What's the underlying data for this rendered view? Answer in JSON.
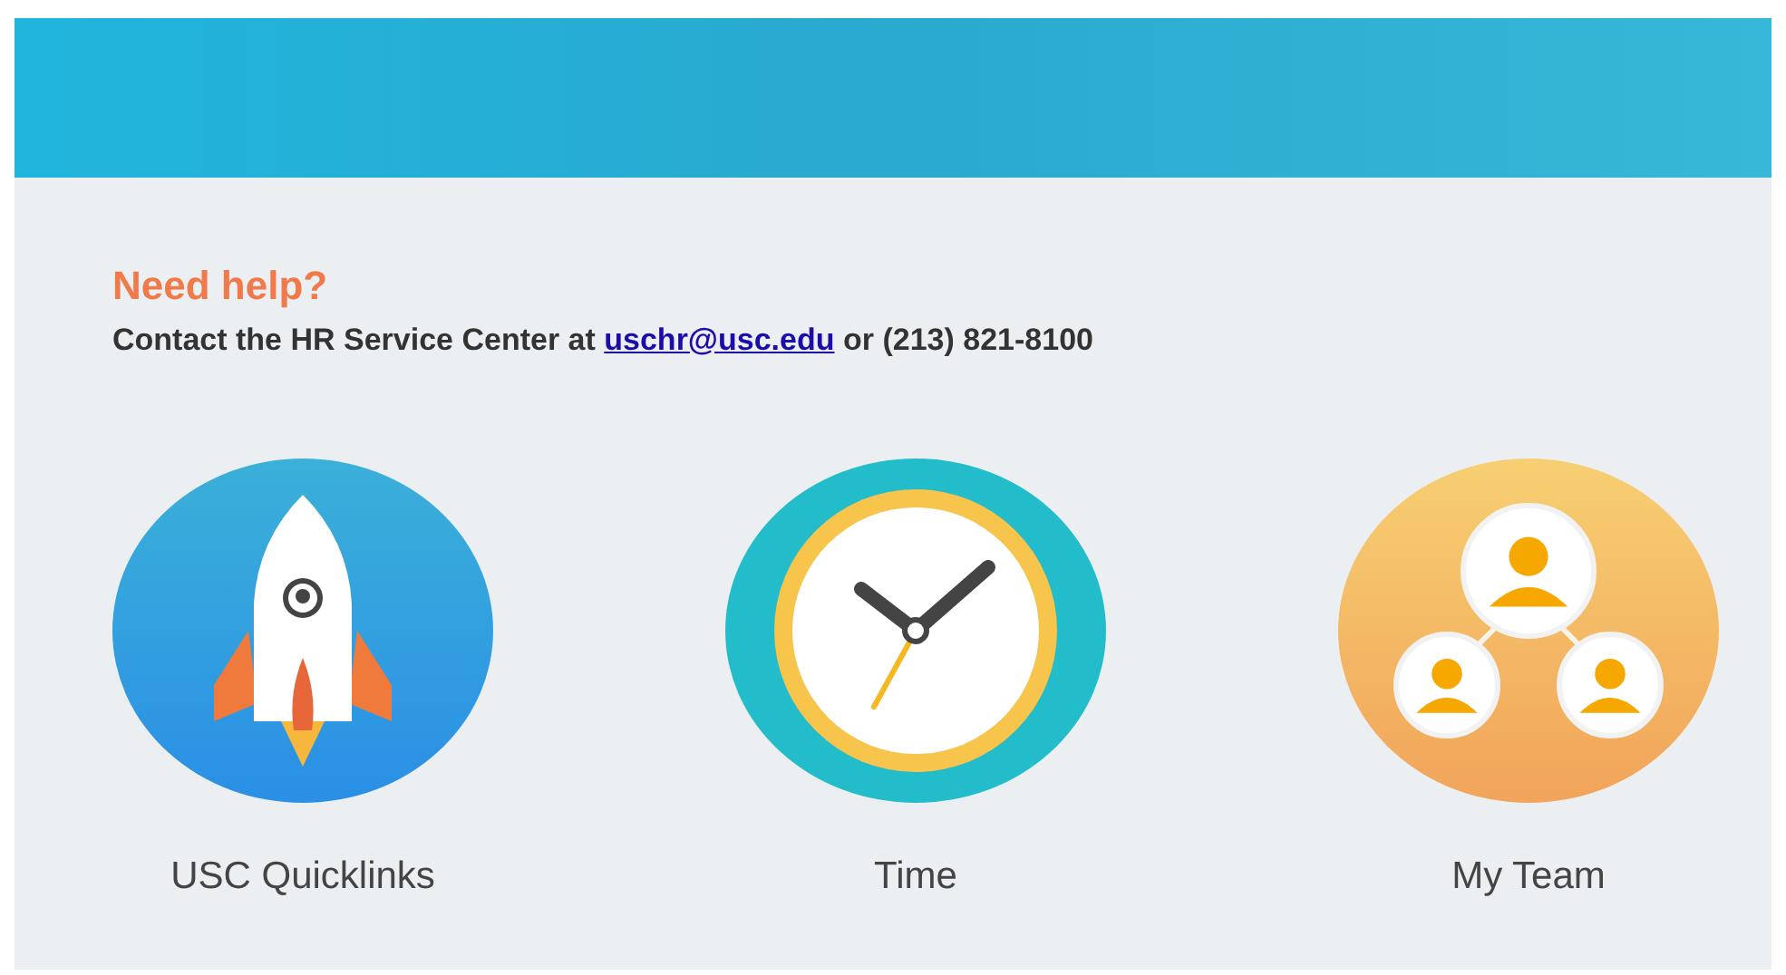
{
  "help": {
    "title": "Need help?",
    "text_before": "Contact the HR Service Center at",
    "link": "uschr@usc.edu",
    "text_after": "or (213) 821-8100"
  },
  "apps": [
    {
      "kind": "rocket",
      "label": "USC Quicklinks"
    },
    {
      "kind": "clock",
      "label": "Time"
    },
    {
      "kind": "team",
      "label": "My Team"
    }
  ]
}
